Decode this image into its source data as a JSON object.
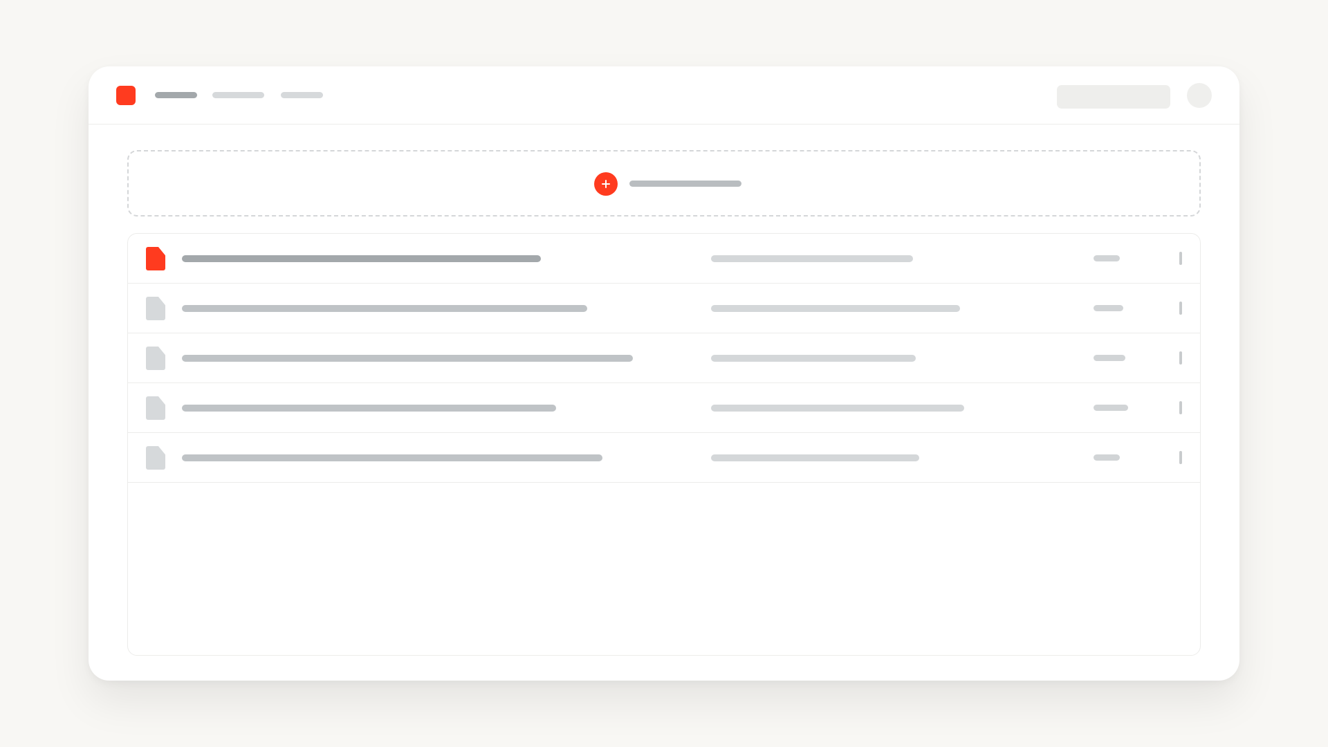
{
  "colors": {
    "accent": "#ff3b1f",
    "skeleton_dark": "#a3a8ab",
    "skeleton_medium": "#bfc3c6",
    "skeleton_light": "#d4d7d9",
    "page_background": "#f8f7f4"
  },
  "header": {
    "logo_icon": "app-logo-icon",
    "nav_items": [
      {
        "label": "",
        "active": true
      },
      {
        "label": "",
        "active": false
      },
      {
        "label": "",
        "active": false
      }
    ],
    "search": {
      "placeholder": ""
    },
    "avatar_icon": "avatar-icon"
  },
  "upload": {
    "icon": "add-icon",
    "label": ""
  },
  "files": {
    "rows": [
      {
        "name": "",
        "meta": "",
        "size": "",
        "active": true
      },
      {
        "name": "",
        "meta": "",
        "size": "",
        "active": false
      },
      {
        "name": "",
        "meta": "",
        "size": "",
        "active": false
      },
      {
        "name": "",
        "meta": "",
        "size": "",
        "active": false
      },
      {
        "name": "",
        "meta": "",
        "size": "",
        "active": false
      }
    ],
    "row_icon": "file-icon",
    "menu_icon": "row-menu-icon"
  }
}
